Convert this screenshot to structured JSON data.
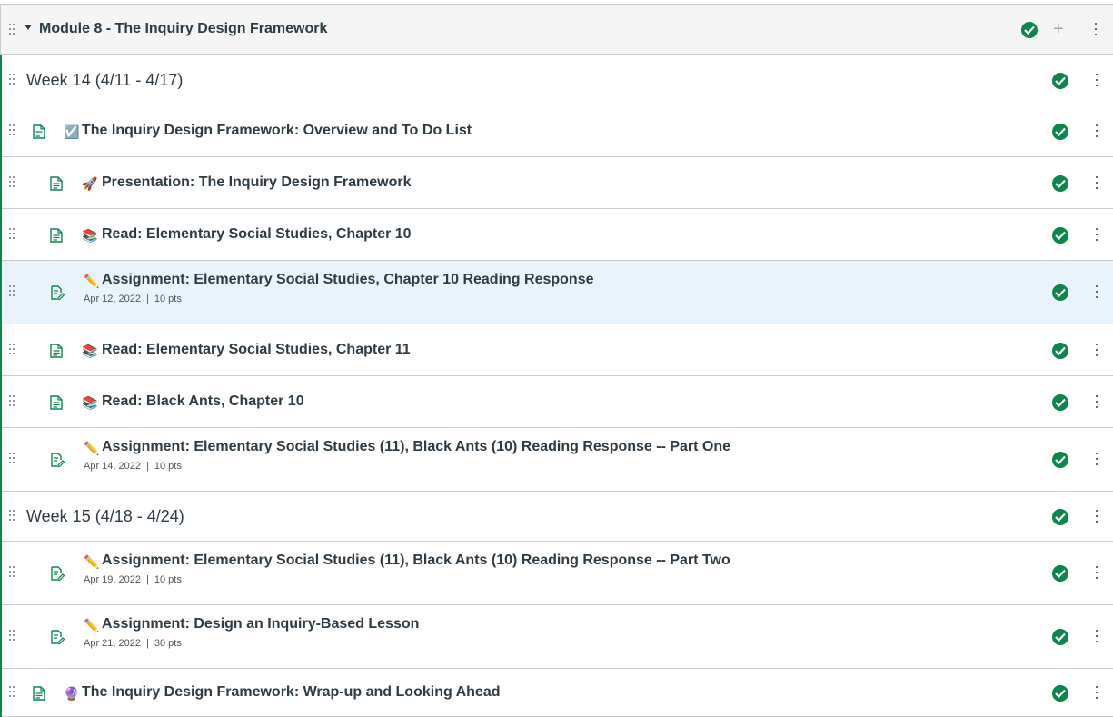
{
  "module": {
    "title": "Module 8 - The Inquiry Design Framework"
  },
  "rows": [
    {
      "kind": "subheader",
      "title": "Week 14 (4/11 - 4/17)"
    },
    {
      "kind": "page",
      "emoji": "☑️",
      "title": "The Inquiry Design Framework: Overview and To Do List"
    },
    {
      "kind": "page",
      "emoji": "🚀",
      "title": "Presentation: The Inquiry Design Framework"
    },
    {
      "kind": "page",
      "emoji": "📚",
      "title": "Read: Elementary Social Studies, Chapter 10"
    },
    {
      "kind": "assignment",
      "emoji": "✏️",
      "title": "Assignment: Elementary Social Studies, Chapter 10 Reading Response",
      "date": "Apr 12, 2022",
      "points": "10 pts"
    },
    {
      "kind": "page",
      "emoji": "📚",
      "title": "Read: Elementary Social Studies, Chapter 11"
    },
    {
      "kind": "page",
      "emoji": "📚",
      "title": "Read: Black Ants, Chapter 10"
    },
    {
      "kind": "assignment",
      "emoji": "✏️",
      "title": "Assignment: Elementary Social Studies (11), Black Ants (10) Reading Response -- Part One",
      "date": "Apr 14, 2022",
      "points": "10 pts"
    },
    {
      "kind": "subheader",
      "title": "Week 15 (4/18 - 4/24)"
    },
    {
      "kind": "assignment",
      "emoji": "✏️",
      "title": "Assignment: Elementary Social Studies (11), Black Ants (10) Reading Response -- Part Two",
      "date": "Apr 19, 2022",
      "points": "10 pts"
    },
    {
      "kind": "assignment",
      "emoji": "✏️",
      "title": "Assignment: Design an Inquiry-Based Lesson",
      "date": "Apr 21, 2022",
      "points": "30 pts"
    },
    {
      "kind": "page",
      "emoji": "🔮",
      "title": "The Inquiry Design Framework: Wrap-up and Looking Ahead"
    }
  ],
  "separator": "|",
  "icons": {
    "published": "published-check-icon",
    "add": "plus-icon",
    "menu": "kebab-menu-icon",
    "drag": "drag-handle-icon",
    "page": "page-icon",
    "assignment": "assignment-icon"
  },
  "colors": {
    "published": "#0b874b",
    "highlight": "#e8f3fb",
    "module_border": "#0b874b"
  }
}
